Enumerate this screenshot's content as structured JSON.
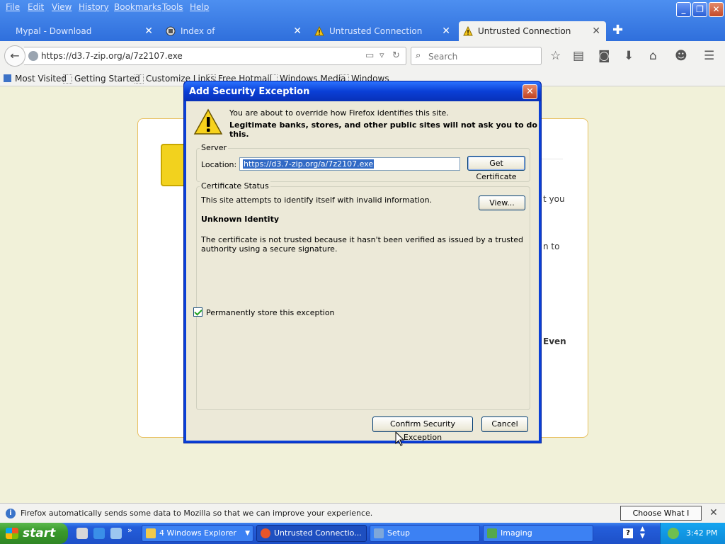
{
  "menu": [
    "File",
    "Edit",
    "View",
    "History",
    "Bookmarks",
    "Tools",
    "Help"
  ],
  "tabs": [
    {
      "label": "Mypal - Download",
      "active": false
    },
    {
      "label": "Index of /~lily/ISOs/crustywi...",
      "active": false
    },
    {
      "label": "Untrusted Connection",
      "active": false
    },
    {
      "label": "Untrusted Connection",
      "active": true
    }
  ],
  "nav": {
    "url": "https://d3.7-zip.org/a/7z2107.exe",
    "search_placeholder": "Search"
  },
  "bookmarks": [
    "Most Visited",
    "Getting Started",
    "Customize Links",
    "Free Hotmail",
    "Windows Media",
    "Windows"
  ],
  "page_fragments": [
    "t you",
    "n to",
    "Even"
  ],
  "dialog": {
    "title": "Add Security Exception",
    "intro_line1": "You are about to override how Firefox identifies this site.",
    "intro_line2": "Legitimate banks, stores, and other public sites will not ask you to do this.",
    "server_group": "Server",
    "location_label": "Location:",
    "location_value": "https://d3.7-zip.org/a/7z2107.exe",
    "get_certificate": "Get Certificate",
    "status_group": "Certificate Status",
    "status_line": "This site attempts to identify itself with invalid information.",
    "view_button": "View...",
    "unknown_identity": "Unknown Identity",
    "explanation": "The certificate is not trusted because it hasn't been verified as issued by a trusted authority using a secure signature.",
    "permanent_label": "Permanently store this exception",
    "permanent_checked": true,
    "confirm_button": "Confirm Security Exception",
    "cancel_button": "Cancel"
  },
  "notification": {
    "message": "Firefox automatically sends some data to Mozilla so that we can improve your experience.",
    "share_button": "Choose What I Share"
  },
  "taskbar": {
    "start": "start",
    "tasks": [
      {
        "label": "4 Windows Explorer",
        "icon_color": "#f2c94c"
      },
      {
        "label": "Untrusted Connectio...",
        "icon_color": "#e8552a"
      },
      {
        "label": "Setup",
        "icon_color": "#7fa7d9"
      },
      {
        "label": "Imaging",
        "icon_color": "#55a84c"
      }
    ],
    "clock": "3:42 PM"
  },
  "colors": {
    "titlebar": "#0a3fd6",
    "tabstrip": "#3c7be0",
    "page_bg": "#f1f1d9",
    "card_border": "#e8c060"
  }
}
